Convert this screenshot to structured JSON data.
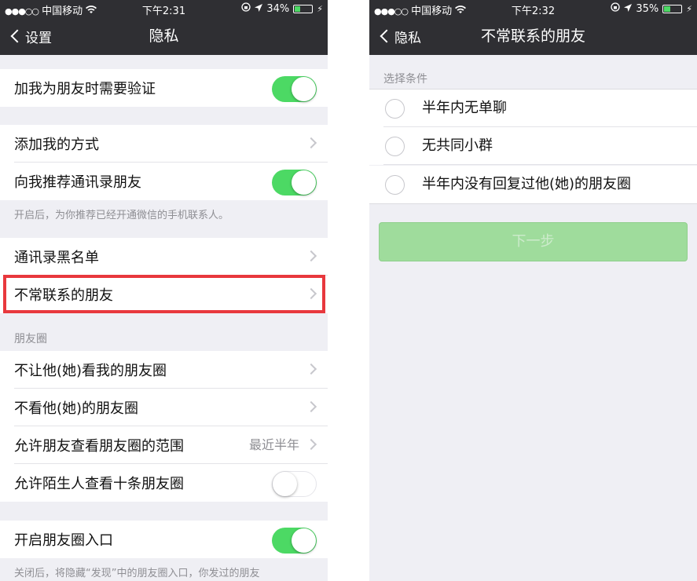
{
  "left": {
    "status": {
      "carrier": "中国移动",
      "time": "下午2:31",
      "battery": "34%",
      "battery_level": 0.34
    },
    "nav": {
      "back_label": "设置",
      "title": "隐私"
    },
    "rows": {
      "verify": "加我为朋友时需要验证",
      "add_me": "添加我的方式",
      "recommend": "向我推荐通讯录朋友",
      "recommend_note": "开启后，为你推荐已经开通微信的手机联系人。",
      "blacklist": "通讯录黑名单",
      "infrequent": "不常联系的朋友",
      "moments_header": "朋友圈",
      "block_view_mine": "不让他(她)看我的朋友圈",
      "hide_theirs": "不看他(她)的朋友圈",
      "range": "允许朋友查看朋友圈的范围",
      "range_value": "最近半年",
      "strangers": "允许陌生人查看十条朋友圈",
      "entry": "开启朋友圈入口",
      "entry_note": "关闭后，将隐藏“发现”中的朋友圈入口，你发过的朋友"
    },
    "switches": {
      "verify": true,
      "recommend": true,
      "strangers": false,
      "entry": true
    }
  },
  "right": {
    "status": {
      "carrier": "中国移动",
      "time": "下午2:32",
      "battery": "35%",
      "battery_level": 0.35
    },
    "nav": {
      "back_label": "隐私",
      "title": "不常联系的朋友"
    },
    "section_header": "选择条件",
    "options": [
      "半年内无单聊",
      "无共同小群",
      "半年内没有回复过他(她)的朋友圈"
    ],
    "next_button": "下一步"
  },
  "colors": {
    "nav_bg": "#2f2f33",
    "switch_on": "#4cd964",
    "highlight": "#e8383d",
    "button_disabled": "#9fdc9c",
    "page_bg": "#efeff4"
  }
}
